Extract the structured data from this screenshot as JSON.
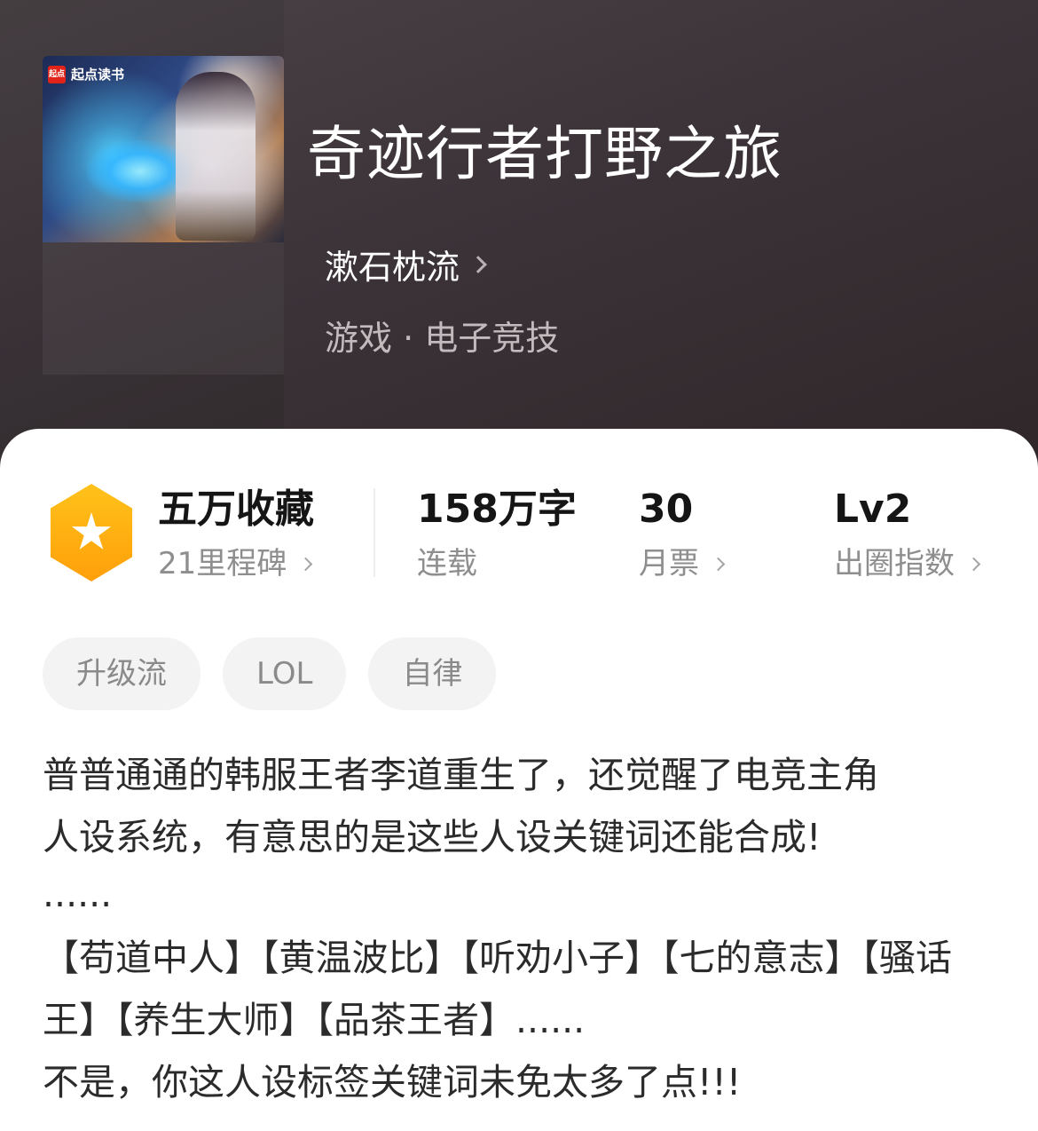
{
  "cover": {
    "brand": "起点读书",
    "logo_text": "起点"
  },
  "book": {
    "title": "奇迹行者打野之旅",
    "author": "漱石枕流",
    "genre": "游戏 · 电子竞技"
  },
  "stats": {
    "milestone_title": "五万收藏",
    "milestone_sub": "21里程碑",
    "words_value": "158万字",
    "words_label": "连载",
    "votes_value": "30",
    "votes_label": "月票",
    "level_value": "Lv2",
    "level_label": "出圈指数"
  },
  "tags": [
    "升级流",
    "LOL",
    "自律"
  ],
  "description": {
    "lines": [
      "普普通通的韩服王者李道重生了，还觉醒了电竞主角",
      "人设系统，有意思的是这些人设关键词还能合成!",
      "......",
      "【苟道中人】【黄温波比】【听劝小子】【七的意志】【骚话",
      "王】【养生大师】【品茶王者】......",
      "不是，你这人设标签关键词未免太多了点!!!"
    ]
  },
  "colors": {
    "header_bg": "#3b3338",
    "hex_badge": "#ffb012",
    "tag_bg": "#f3f3f3"
  }
}
